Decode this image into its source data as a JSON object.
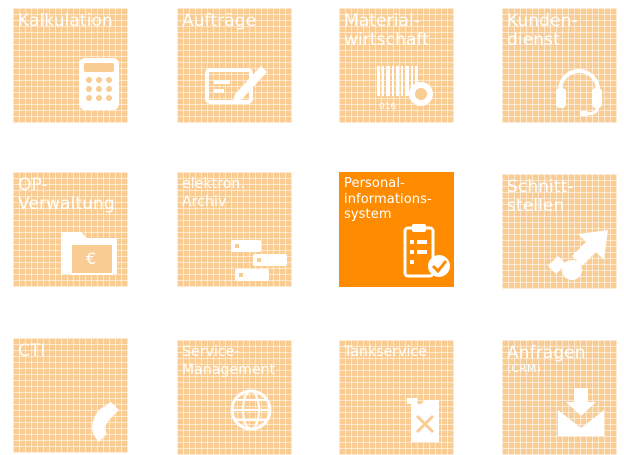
{
  "colors": {
    "tile_light": "#f8cc92",
    "tile_active": "#ff8c00",
    "text": "#ffffff"
  },
  "tiles": [
    {
      "lines": [
        "Kalkulation"
      ],
      "icon": "calculator-icon"
    },
    {
      "lines": [
        "Aufträge"
      ],
      "icon": "pen-document-icon"
    },
    {
      "lines": [
        "Material-",
        "wirtschaft"
      ],
      "icon": "barcode-icon",
      "icon_text": "016"
    },
    {
      "lines": [
        "Kunden-",
        "dienst"
      ],
      "icon": "headset-icon"
    },
    {
      "lines": [
        "OP-",
        "Verwaltung"
      ],
      "icon": "euro-folder-icon",
      "icon_text": "€"
    },
    {
      "lines": [
        "elektron.",
        "Archiv"
      ],
      "icon": "archive-boxes-icon"
    },
    {
      "lines": [
        "Personal-",
        "informations-",
        "system"
      ],
      "icon": "clipboard-check-icon",
      "active": true
    },
    {
      "lines": [
        "Schnitt-",
        "stellen"
      ],
      "icon": "interface-arrows-icon"
    },
    {
      "lines": [
        "CTI"
      ],
      "icon": "phone-icon"
    },
    {
      "lines": [
        "Service-",
        "Management"
      ],
      "icon": "globe-icon"
    },
    {
      "lines": [
        "Tankservice"
      ],
      "icon": "fuel-canister-icon"
    },
    {
      "lines": [
        "Anfragen"
      ],
      "sub": "(CRM)",
      "icon": "envelope-down-icon"
    }
  ]
}
